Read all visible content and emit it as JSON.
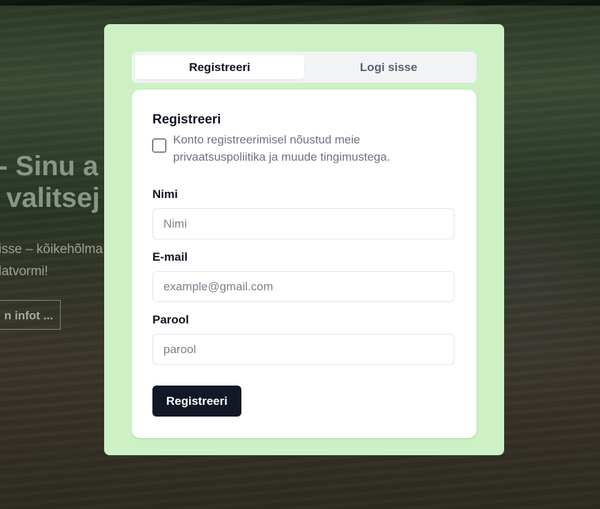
{
  "hero": {
    "title_line1": "- Sinu a",
    "title_line2": " valitsej",
    "text_line1": "isse – kõikehõlma",
    "text_line2": "latvormi!",
    "more_button": "n infot ..."
  },
  "tabs": [
    {
      "label": "Registreeri",
      "active": true
    },
    {
      "label": "Logi sisse",
      "active": false
    }
  ],
  "form": {
    "title": "Registreeri",
    "consent_text": "Konto registreerimisel nõustud meie privaatsuspoliitika ja muude tingimustega.",
    "consent_checked": false,
    "fields": {
      "name": {
        "label": "Nimi",
        "placeholder": "Nimi",
        "value": ""
      },
      "email": {
        "label": "E-mail",
        "placeholder": "example@gmail.com",
        "value": ""
      },
      "password": {
        "label": "Parool",
        "placeholder": "parool",
        "value": ""
      }
    },
    "submit_label": "Registreeri"
  },
  "colors": {
    "modal_bg": "#cdf1c5",
    "card_bg": "#ffffff",
    "primary_button": "#121826"
  }
}
